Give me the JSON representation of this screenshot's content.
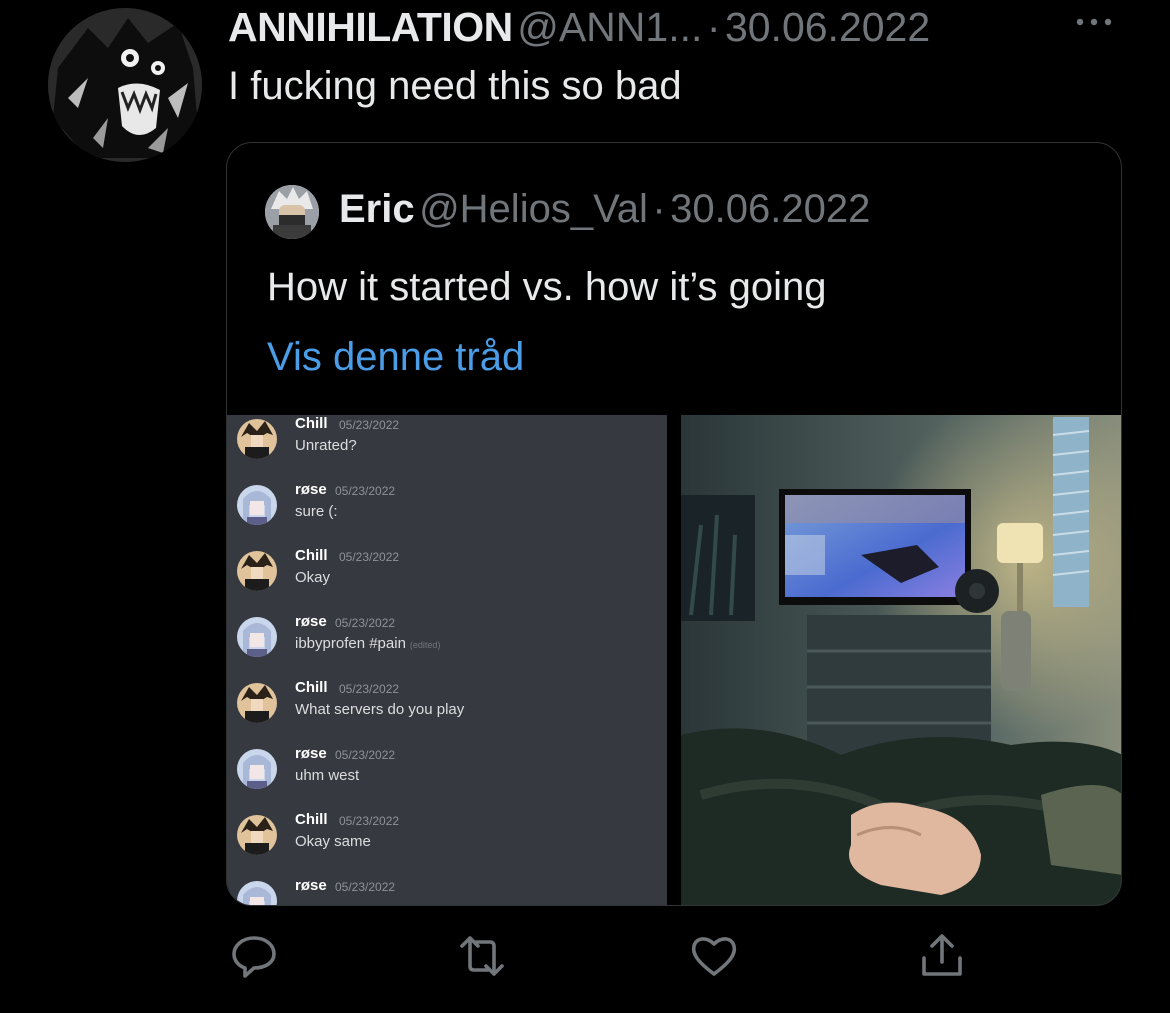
{
  "tweet": {
    "display_name": "ANNIHILATION",
    "handle": "@ANN1...",
    "separator": "·",
    "date": "30.06.2022",
    "text": "I fucking need this so bad"
  },
  "quote": {
    "display_name": "Eric",
    "handle": "@Helios_Val",
    "separator": "·",
    "date": "30.06.2022",
    "text": "How it started vs. how it’s going",
    "thread_link": "Vis denne tråd"
  },
  "chat": {
    "messages": [
      {
        "user": "Chill",
        "timestamp": "05/23/2022",
        "text": "Unrated?",
        "edited": ""
      },
      {
        "user": "røse",
        "timestamp": "05/23/2022",
        "text": "sure (:",
        "edited": ""
      },
      {
        "user": "Chill",
        "timestamp": "05/23/2022",
        "text": "Okay",
        "edited": ""
      },
      {
        "user": "røse",
        "timestamp": "05/23/2022",
        "text": "ibbyprofen #pain",
        "edited": "(edited)"
      },
      {
        "user": "Chill",
        "timestamp": "05/23/2022",
        "text": "What servers do you play",
        "edited": ""
      },
      {
        "user": "røse",
        "timestamp": "05/23/2022",
        "text": "uhm west",
        "edited": ""
      },
      {
        "user": "Chill",
        "timestamp": "05/23/2022",
        "text": "Okay same",
        "edited": ""
      },
      {
        "user": "røse",
        "timestamp": "05/23/2022",
        "text": "",
        "edited": ""
      }
    ]
  },
  "actions": {
    "icons": [
      "reply-icon",
      "retweet-icon",
      "like-icon",
      "share-icon"
    ]
  },
  "colors": {
    "background": "#000000",
    "primary_text": "#e7e9ea",
    "secondary_text": "#71767b",
    "link": "#4a9de6",
    "discord_bg": "#36393f"
  }
}
